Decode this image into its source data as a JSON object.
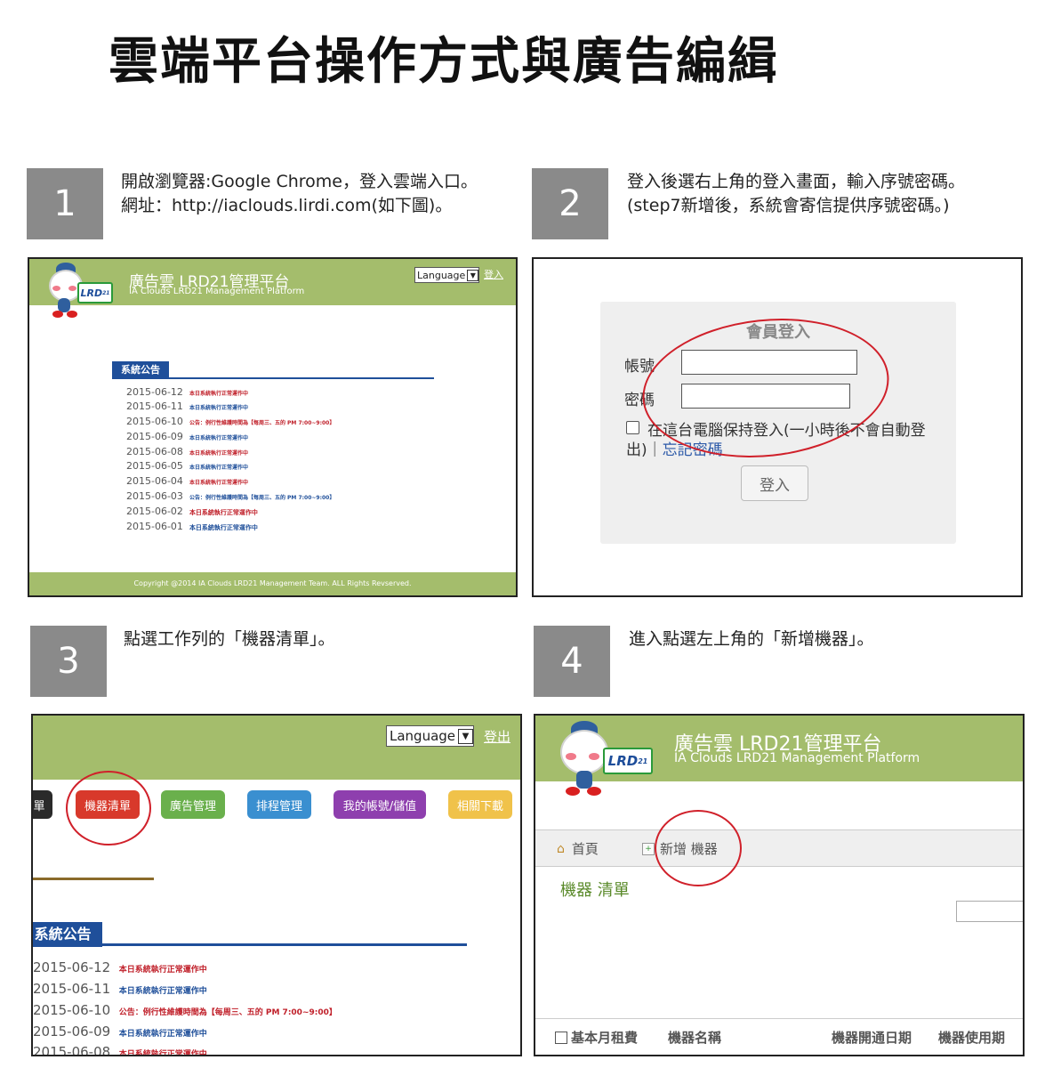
{
  "page_title": "雲端平台操作方式與廣告編緝",
  "steps": [
    {
      "number": "1",
      "lines": [
        "開啟瀏覽器:Google Chrome，登入雲端入口。",
        "網址：http://iaclouds.lirdi.com(如下圖)。"
      ]
    },
    {
      "number": "2",
      "lines": [
        "登入後選右上角的登入畫面，輸入序號密碼。",
        "(step7新增後，系統會寄信提供序號密碼。)"
      ]
    },
    {
      "number": "3",
      "lines": [
        "點選工作列的「機器清單」。"
      ]
    },
    {
      "number": "4",
      "lines": [
        "進入點選左上角的「新增機器」。"
      ]
    }
  ],
  "platform": {
    "name": "廣告雲 LRD21管理平台",
    "subtitle": "IA Clouds LRD21 Management Platform",
    "logo_text": "LRD",
    "logo_sup": "21",
    "language_label": "Language",
    "login_link": "登入",
    "logout_link": "登出",
    "copyright": "Copyright @2014 IA Clouds LRD21 Management Team. ALL Rights Revserved."
  },
  "notices": {
    "tab_label": "系統公告",
    "tab_label_cropped": "系統公告",
    "items": [
      {
        "date": "2015-06-12",
        "text": "本日系統執行正常運作中"
      },
      {
        "date": "2015-06-11",
        "text": "本日系統執行正常運作中"
      },
      {
        "date": "2015-06-10",
        "text": "公告：例行性維護時間為【每周三、五的 PM 7:00~9:00】"
      },
      {
        "date": "2015-06-09",
        "text": "本日系統執行正常運作中"
      },
      {
        "date": "2015-06-08",
        "text": "本日系統執行正常運作中"
      },
      {
        "date": "2015-06-05",
        "text": "本日系統執行正常運作中"
      },
      {
        "date": "2015-06-04",
        "text": "本日系統執行正常運作中"
      },
      {
        "date": "2015-06-03",
        "text": "公告：例行性維護時間為【每周三、五的 PM 7:00~9:00】"
      },
      {
        "date": "2015-06-02",
        "text": "本日系統執行正常運作中"
      },
      {
        "date": "2015-06-01",
        "text": "本日系統執行正常運作中"
      }
    ]
  },
  "login_form": {
    "heading": "會員登入",
    "account_label": "帳號",
    "password_label": "密碼",
    "remember_text_1": "在這台電腦保持登入(一小時後不會自動登",
    "remember_text_2": "出)｜",
    "forgot_link": "忘記密碼",
    "submit_label": "登入"
  },
  "nav_tabs": [
    {
      "label": "單",
      "color": "#2a2a2a"
    },
    {
      "label": "機器清單",
      "color": "#d8392b"
    },
    {
      "label": "廣告管理",
      "color": "#6ab04c"
    },
    {
      "label": "排程管理",
      "color": "#3a8fd0"
    },
    {
      "label": "我的帳號/儲值",
      "color": "#8e3fae"
    },
    {
      "label": "相關下載",
      "color": "#f0c24a"
    }
  ],
  "machine_page": {
    "home_label": "首頁",
    "add_machine_label": "新增 機器",
    "list_title": "機器 清單",
    "columns": [
      "基本月租費",
      "機器名稱",
      "機器開通日期",
      "機器使用期"
    ]
  },
  "colors": {
    "header_green": "#a4bd6c",
    "notice_blue": "#1f4f9a",
    "highlight_red": "#d0202a",
    "step_gray": "#8a8a8a"
  }
}
